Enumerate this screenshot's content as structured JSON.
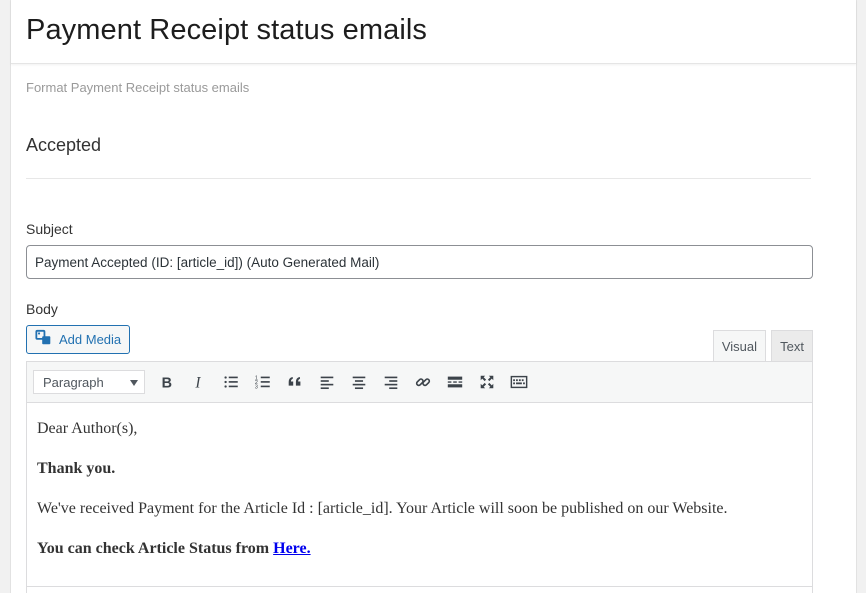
{
  "header": {
    "title": "Payment Receipt status emails"
  },
  "section": {
    "description": "Format Payment Receipt status emails",
    "heading": "Accepted"
  },
  "subject": {
    "label": "Subject",
    "value": "Payment Accepted (ID: [article_id]) (Auto Generated Mail)"
  },
  "body": {
    "label": "Body",
    "add_media_label": "Add Media",
    "tabs": {
      "visual": "Visual",
      "text": "Text"
    },
    "format_select": "Paragraph",
    "toolbar_icons": [
      "bold-icon",
      "italic-icon",
      "bullet-list-icon",
      "numbered-list-icon",
      "blockquote-icon",
      "align-left-icon",
      "align-center-icon",
      "align-right-icon",
      "link-icon",
      "read-more-icon",
      "fullscreen-icon",
      "toolbar-toggle-icon"
    ],
    "content": {
      "greeting": "Dear Author(s),",
      "thanks": "Thank you.",
      "message": "We've received Payment for the Article Id : [article_id]. Your Article will soon be published on our Website.",
      "status_prefix": "You can check Article Status from ",
      "status_link": "Here."
    }
  },
  "colors": {
    "accent": "#2271b1",
    "link": "#0000ee"
  }
}
